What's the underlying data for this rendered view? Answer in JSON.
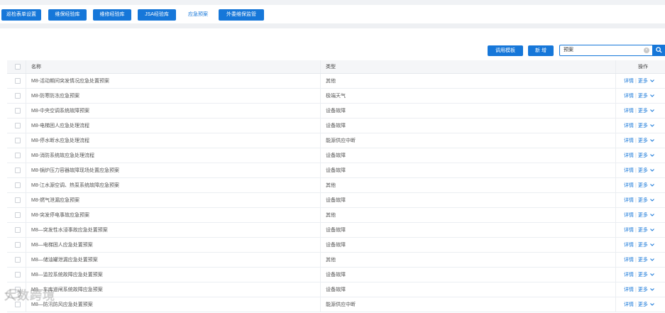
{
  "tabs": [
    {
      "label": "巡检表单设置",
      "active": true
    },
    {
      "label": "维保经验库",
      "active": true
    },
    {
      "label": "维修经验库",
      "active": true
    },
    {
      "label": "JSA经验库",
      "active": true
    },
    {
      "label": "应急预案",
      "active": false
    },
    {
      "label": "外委维保监管",
      "active": true
    }
  ],
  "toolbar": {
    "template_label": "调用模板",
    "add_label": "新 增",
    "search_value": "预案",
    "clear_glyph": "×"
  },
  "table": {
    "headers": {
      "name": "名称",
      "type": "类型",
      "ops": "操作"
    },
    "rows": [
      {
        "name": "M8-活动期间突发情况应急处置预案",
        "type": "其他"
      },
      {
        "name": "M8-防寒防冻应急预案",
        "type": "极端天气"
      },
      {
        "name": "M8-中央空调系统故障预案",
        "type": "设备故障"
      },
      {
        "name": "M8-电梯困人应急处理流程",
        "type": "设备故障"
      },
      {
        "name": "M8-停水断水应急处理流程",
        "type": "能源供应中断"
      },
      {
        "name": "M8-消防系统故应急处理流程",
        "type": "设备故障"
      },
      {
        "name": "M8-锅炉压力容器故障现场处置应急预案",
        "type": "设备故障"
      },
      {
        "name": "M8-江水源空调、热泵系统故障应急预案",
        "type": "其他"
      },
      {
        "name": "M8-燃气泄漏应急预案",
        "type": "设备故障"
      },
      {
        "name": "M8-突发停电事故应急预案",
        "type": "其他"
      },
      {
        "name": "M8—突发性水浸事故应急处置预案",
        "type": "设备故障"
      },
      {
        "name": "M8—电梯困人应急处置预案",
        "type": "设备故障"
      },
      {
        "name": "M8—储油罐泄漏应急处置预案",
        "type": "其他"
      },
      {
        "name": "M8—监控系统故障应急处置预案",
        "type": "设备故障"
      },
      {
        "name": "M8—车库道闸系统故障应急预案",
        "type": "设备故障"
      },
      {
        "name": "M8—防汛防风应急处置预案",
        "type": "能源供应中断"
      }
    ],
    "op_detail": "详情",
    "op_sep": "|",
    "op_more": "更多"
  },
  "watermark": "大数跨境",
  "colors": {
    "accent": "#1677d9",
    "header_bg": "#f5f6f8"
  }
}
